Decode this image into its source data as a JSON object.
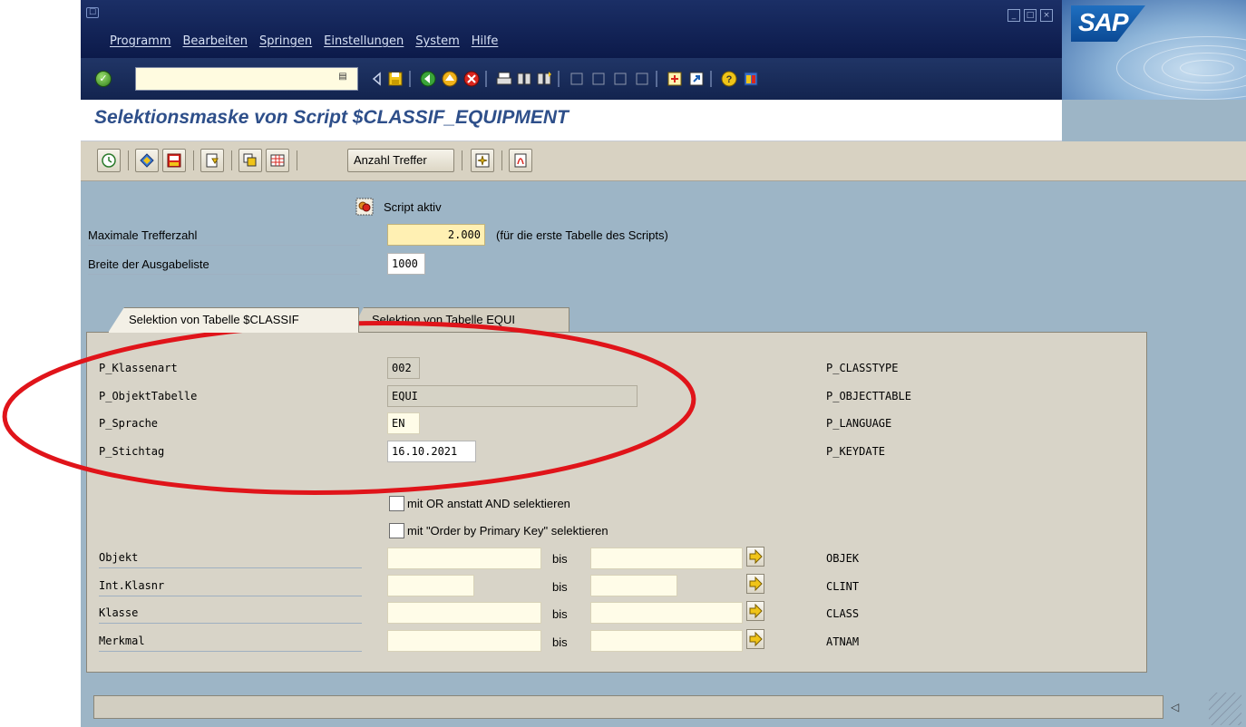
{
  "menu": {
    "items": [
      "Programm",
      "Bearbeiten",
      "Springen",
      "Einstellungen",
      "System",
      "Hilfe"
    ]
  },
  "logo_text": "SAP",
  "screen_title": "Selektionsmaske von Script $CLASSIF_EQUIPMENT",
  "app_toolbar": {
    "anzahl_label": "Anzahl Treffer"
  },
  "header": {
    "script_aktiv_label": "Script aktiv",
    "max_treffer_label": "Maximale Trefferzahl",
    "max_treffer_value": "2.000",
    "max_treffer_note": "(für die erste Tabelle des Scripts)",
    "breite_label": "Breite der Ausgabeliste",
    "breite_value": "1000"
  },
  "tabs": [
    {
      "label": "Selektion von Tabelle $CLASSIF"
    },
    {
      "label": "Selektion von Tabelle EQUI"
    }
  ],
  "params": [
    {
      "label": "P_Klassenart",
      "value": "002",
      "tech": "P_CLASSTYPE"
    },
    {
      "label": "P_ObjektTabelle",
      "value": "EQUI",
      "tech": "P_OBJECTTABLE"
    },
    {
      "label": "P_Sprache",
      "value": "EN",
      "tech": "P_LANGUAGE"
    },
    {
      "label": "P_Stichtag",
      "value": "16.10.2021",
      "tech": "P_KEYDATE"
    }
  ],
  "checkboxes": [
    {
      "label": "mit OR anstatt AND selektieren",
      "checked": false
    },
    {
      "label": "mit \"Order by Primary Key\" selektieren",
      "checked": false
    }
  ],
  "ranges": {
    "bis_label": "bis",
    "rows": [
      {
        "label": "Objekt",
        "tech": "OBJEK"
      },
      {
        "label": "Int.Klasnr",
        "tech": "CLINT"
      },
      {
        "label": "Klasse",
        "tech": "CLASS"
      },
      {
        "label": "Merkmal",
        "tech": "ATNAM"
      }
    ]
  },
  "colors": {
    "menubar": "#13244f",
    "title_blue": "#2e4f8a",
    "background": "#9db5c6",
    "panel": "#d8d4c8",
    "annotation_red": "#e0141a"
  }
}
